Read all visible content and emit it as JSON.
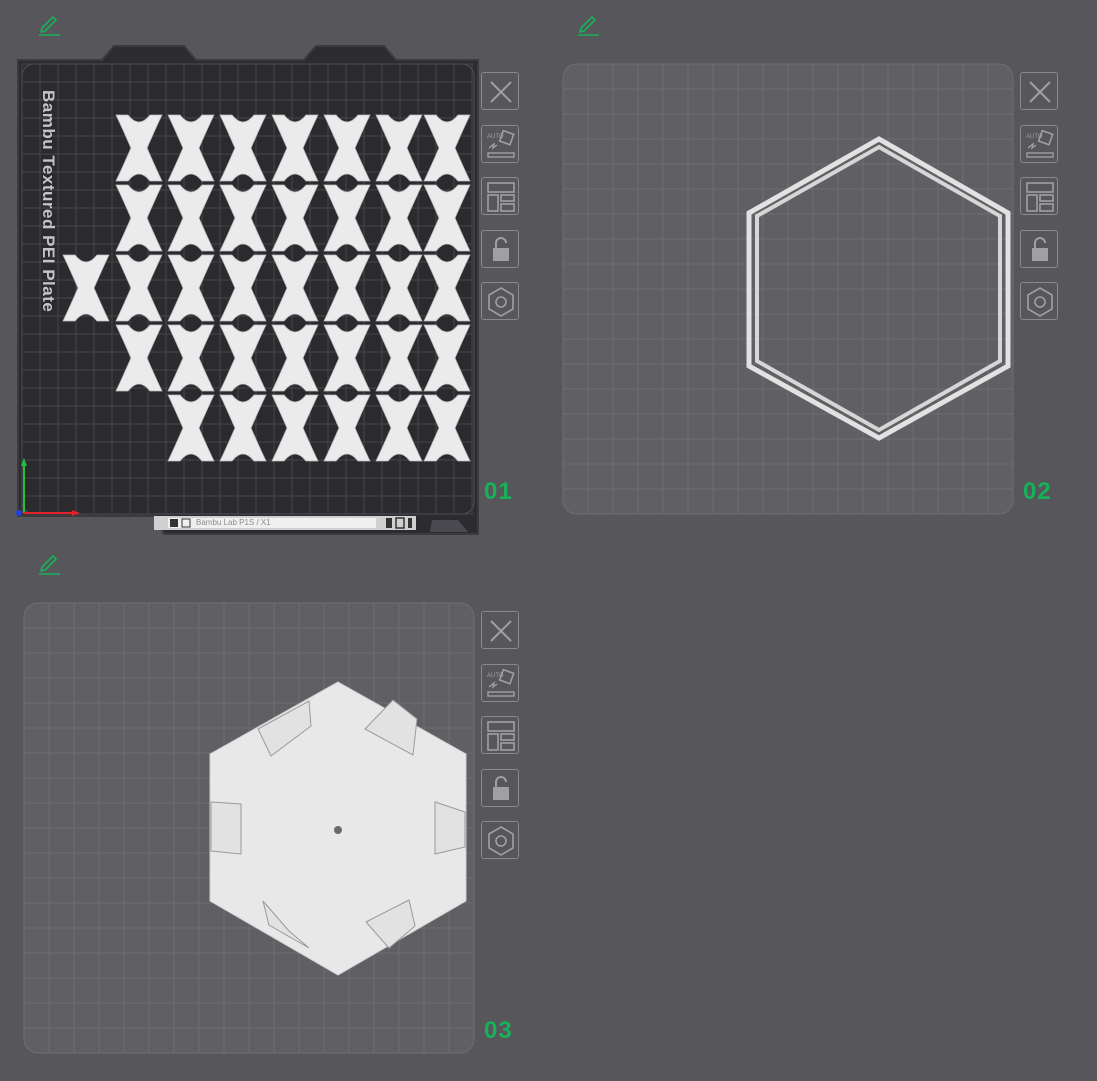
{
  "plates": [
    {
      "number": "01",
      "bed_label": "Bambu Textured PEI Plate",
      "bed_bar_text": "Bambu Lab P1S / X1",
      "selected": true,
      "locked": false,
      "contents": "x-shaped parts"
    },
    {
      "number": "02",
      "selected": false,
      "locked": false,
      "contents": "hexagon frame"
    },
    {
      "number": "03",
      "selected": false,
      "locked": false,
      "contents": "hexagon plate with tabs"
    }
  ],
  "toolbar_icons": [
    "close-icon",
    "auto-orient-icon",
    "arrange-icon",
    "lock-icon",
    "settings-icon"
  ],
  "colors": {
    "background": "#56565b",
    "accent": "#18b159",
    "bed_dark": "#2b2b2f",
    "bed_light": "#5f5f64",
    "part": "#ebebeb"
  }
}
